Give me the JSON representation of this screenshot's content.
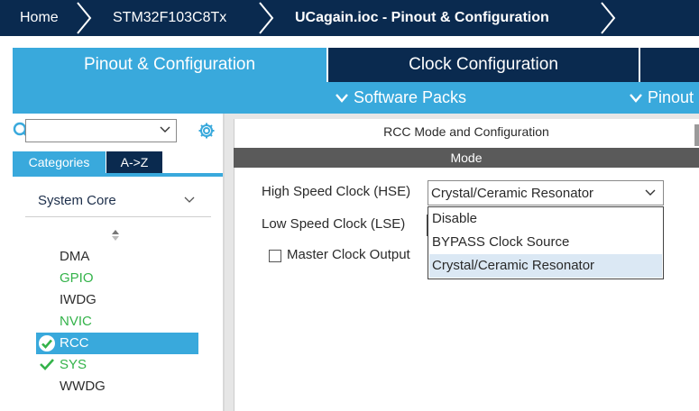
{
  "breadcrumb": [
    {
      "label": "Home",
      "bold": false
    },
    {
      "label": "STM32F103C8Tx",
      "bold": false
    },
    {
      "label": "UCagain.ioc - Pinout & Configuration",
      "bold": true
    }
  ],
  "main_tabs": [
    {
      "label": "Pinout & Configuration",
      "active": true
    },
    {
      "label": "Clock Configuration",
      "active": false
    },
    {
      "label": "",
      "active": false
    }
  ],
  "sub_toolbar": {
    "software_packs": "Software Packs",
    "pinout": "Pinout"
  },
  "left_panel": {
    "search": {
      "value": "",
      "placeholder": ""
    },
    "category_tabs": [
      {
        "label": "Categories",
        "active": true
      },
      {
        "label": "A->Z",
        "active": false
      }
    ],
    "group": "System Core",
    "peripherals": [
      {
        "label": "DMA",
        "state": "default"
      },
      {
        "label": "GPIO",
        "state": "configured"
      },
      {
        "label": "IWDG",
        "state": "default"
      },
      {
        "label": "NVIC",
        "state": "configured"
      },
      {
        "label": "RCC",
        "state": "selected"
      },
      {
        "label": "SYS",
        "state": "configured"
      },
      {
        "label": "WWDG",
        "state": "default"
      }
    ]
  },
  "rcc_panel": {
    "title": "RCC Mode and Configuration",
    "mode_header": "Mode",
    "hse_label": "High Speed Clock (HSE)",
    "hse_value": "Crystal/Ceramic Resonator",
    "lse_label": "Low Speed Clock (LSE)",
    "mco_label": "Master Clock Output",
    "mco_checked": false,
    "hse_options": [
      "Disable",
      "BYPASS Clock Source",
      "Crystal/Ceramic Resonator"
    ],
    "hse_selected_index": 2
  },
  "colors": {
    "navy": "#0a2a4f",
    "accent_blue": "#39a9dc",
    "configured_green": "#34b34a",
    "mode_header_gray": "#5a5a5a",
    "selected_option": "#dbe8f4"
  }
}
